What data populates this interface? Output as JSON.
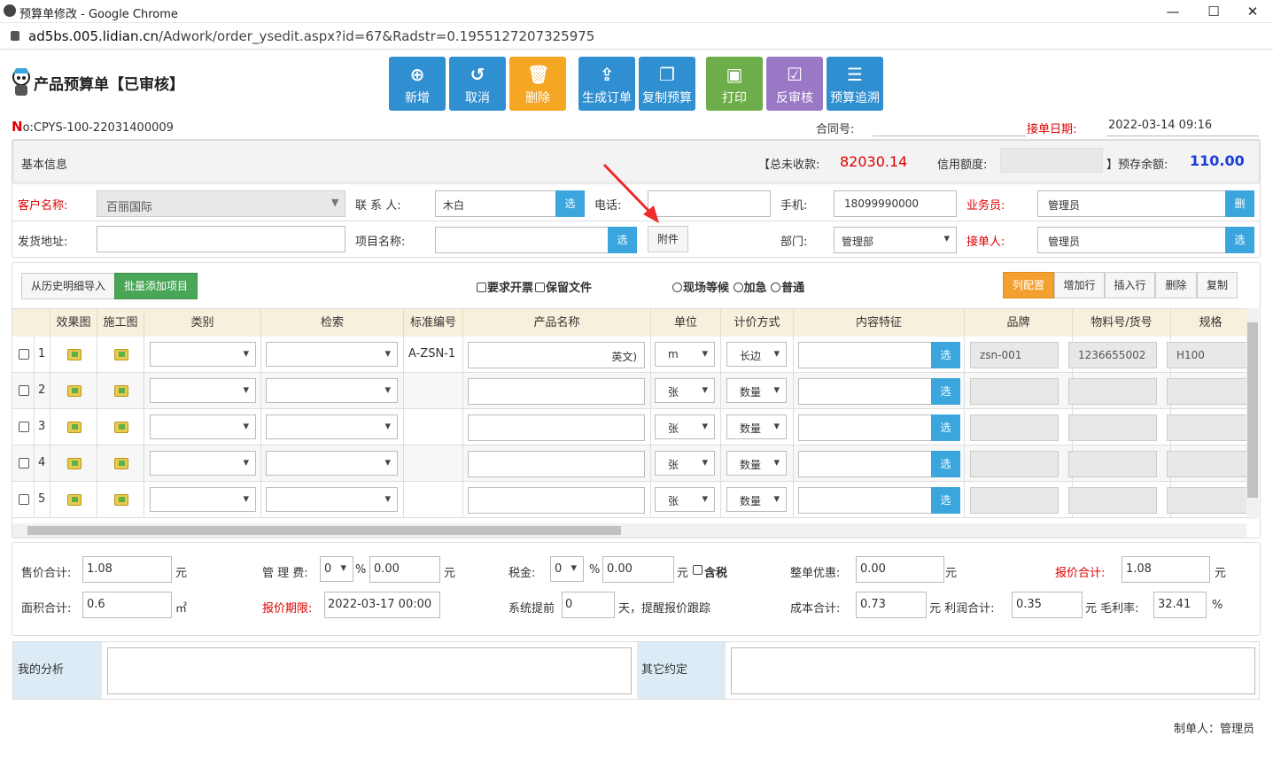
{
  "window": {
    "title": "预算单修改 - Google Chrome",
    "min": "—",
    "max": "☐",
    "close": "✕"
  },
  "address": {
    "host": "ad5bs.005.lidian.cn",
    "path": "/Adwork/order_ysedit.aspx?id=67&Radstr=0.1955127207325975"
  },
  "page": {
    "title": "产品预算单【已审核】"
  },
  "toolbar": [
    {
      "label": "新增",
      "icon": "plus-circle-icon",
      "glyph": "⊕",
      "color": "#2f8fd0"
    },
    {
      "label": "取消",
      "icon": "undo-icon",
      "glyph": "↺",
      "color": "#2f8fd0"
    },
    {
      "label": "删除",
      "icon": "trash-icon",
      "glyph": "🗑",
      "color": "#f5a623"
    },
    {
      "label": "生成订单",
      "icon": "share-icon",
      "glyph": "⇪",
      "color": "#2f8fd0"
    },
    {
      "label": "复制预算",
      "icon": "copy-icon",
      "glyph": "❐",
      "color": "#2f8fd0"
    },
    {
      "label": "打印",
      "icon": "save-icon",
      "glyph": "▣",
      "color": "#6dae4a"
    },
    {
      "label": "反审核",
      "icon": "check-square-icon",
      "glyph": "☑",
      "color": "#9a78c6"
    },
    {
      "label": "预算追溯",
      "icon": "server-icon",
      "glyph": "☰",
      "color": "#2f8fd0"
    }
  ],
  "doc": {
    "no_label": "N",
    "no_suffix": "o:",
    "no": "CPYS-100-22031400009",
    "contract_label": "合同号:",
    "contract": "",
    "order_date_label": "接单日期:",
    "order_date": "2022-03-14 09:16"
  },
  "basic": {
    "header": "基本信息",
    "unpaid_label": "【总未收款:",
    "unpaid": "82030.14",
    "credit_label": "信用额度:",
    "credit": "",
    "prepay_label": "】预存余额:",
    "prepay": "110.00"
  },
  "form": {
    "customer_label": "客户名称:",
    "customer": "百丽国际",
    "contact_label": "联 系 人:",
    "contact": "木白",
    "pick": "选",
    "phone_label": "电话:",
    "phone": "",
    "mobile_label": "手机:",
    "mobile": "18099990000",
    "sales_label": "业务员:",
    "sales": "管理员",
    "del": "删",
    "address_label": "发货地址:",
    "address": "",
    "project_label": "项目名称:",
    "project": "",
    "attach": "附件",
    "dept_label": "部门:",
    "dept": "管理部",
    "receiver_label": "接单人:",
    "receiver": "管理员"
  },
  "detail_toolbar": {
    "import_history": "从历史明细导入",
    "batch_add": "批量添加项目",
    "need_invoice": "要求开票",
    "keep_files": "保留文件",
    "onsite": "现场等候",
    "urgent": "加急",
    "normal": "普通",
    "col_config": "列配置",
    "add_row": "增加行",
    "insert_row": "插入行",
    "delete": "删除",
    "copy": "复制"
  },
  "grid": {
    "headers": [
      "效果图",
      "施工图",
      "类别",
      "检索",
      "标准编号",
      "产品名称",
      "单位",
      "计价方式",
      "内容特征",
      "品牌",
      "物料号/货号",
      "规格"
    ],
    "rows": [
      {
        "n": "1",
        "code": "A-ZSN-1",
        "name": "英文)",
        "unit": "m",
        "price_mode": "长边",
        "brand": "zsn-001",
        "material": "1236655002",
        "spec": "H100"
      },
      {
        "n": "2",
        "code": "",
        "name": "",
        "unit": "张",
        "price_mode": "数量",
        "brand": "",
        "material": "",
        "spec": ""
      },
      {
        "n": "3",
        "code": "",
        "name": "",
        "unit": "张",
        "price_mode": "数量",
        "brand": "",
        "material": "",
        "spec": ""
      },
      {
        "n": "4",
        "code": "",
        "name": "",
        "unit": "张",
        "price_mode": "数量",
        "brand": "",
        "material": "",
        "spec": ""
      },
      {
        "n": "5",
        "code": "",
        "name": "",
        "unit": "张",
        "price_mode": "数量",
        "brand": "",
        "material": "",
        "spec": ""
      }
    ]
  },
  "totals": {
    "sale_total_label": "售价合计:",
    "sale_total": "1.08",
    "yuan": "元",
    "mgmt_fee_label": "管 理 费:",
    "mgmt_fee_pct": "0",
    "pct": "%",
    "mgmt_fee": "0.00",
    "tax_label": "税金:",
    "tax_pct": "0",
    "tax": "0.00",
    "tax_incl": "含税",
    "discount_label": "整单优惠:",
    "discount": "0.00",
    "quote_total_label": "报价合计:",
    "quote_total": "1.08",
    "area_label": "面积合计:",
    "area": "0.6",
    "sqm": "㎡",
    "quote_deadline_label": "报价期限:",
    "quote_deadline": "2022-03-17 00:00",
    "remind_pre_label": "系统提前",
    "remind_days": "0",
    "remind_post": "天，提醒报价跟踪",
    "cost_label": "成本合计:",
    "cost": "0.73",
    "profit_label": "元 利润合计:",
    "profit": "0.35",
    "margin_label": "元 毛利率:",
    "margin": "32.41",
    "margin_unit": "%"
  },
  "notes": {
    "analysis_label": "我的分析",
    "analysis": "",
    "other_label": "其它约定",
    "other": ""
  },
  "footer": {
    "maker": "制单人：管理员"
  }
}
